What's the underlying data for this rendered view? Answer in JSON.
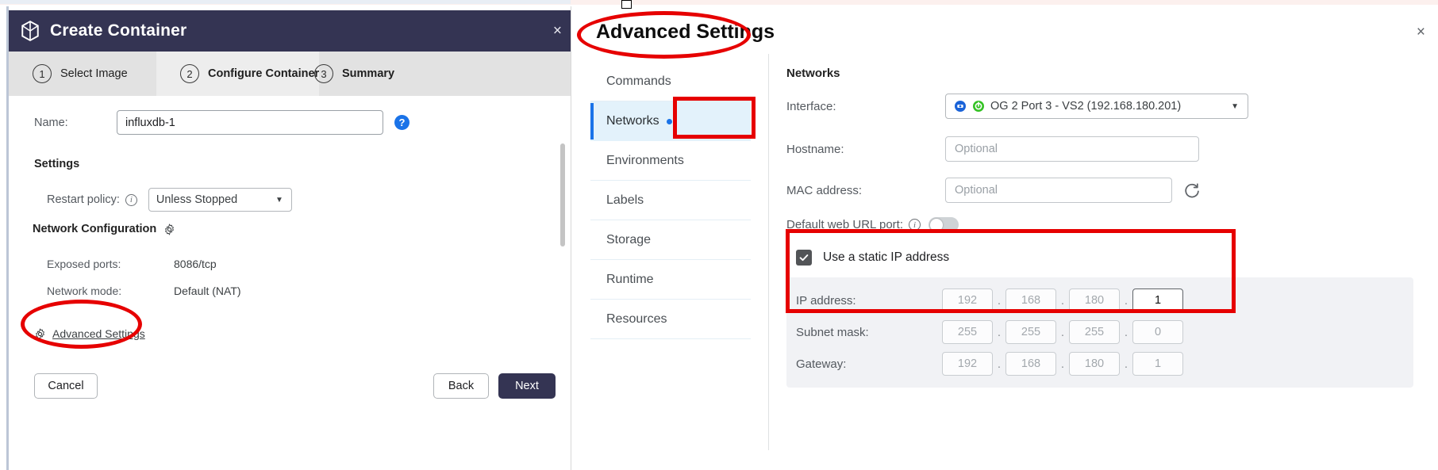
{
  "create_container": {
    "title": "Create Container",
    "title_icon": "cube-icon",
    "close_label": "×",
    "steps": [
      {
        "num": "1",
        "label": "Select Image",
        "active": false
      },
      {
        "num": "2",
        "label": "Configure Container",
        "active": true
      },
      {
        "num": "3",
        "label": "Summary",
        "active": false
      }
    ],
    "name_label": "Name:",
    "name_value": "influxdb-1",
    "name_help_glyph": "?",
    "settings_heading": "Settings",
    "restart_label": "Restart policy:",
    "restart_value": "Unless Stopped",
    "network_config_heading": "Network Configuration",
    "exposed_ports_label": "Exposed ports:",
    "exposed_ports_value": "8086/tcp",
    "network_mode_label": "Network mode:",
    "network_mode_value": "Default (NAT)",
    "advanced_settings_link": "Advanced Settings",
    "cancel_label": "Cancel",
    "back_label": "Back",
    "next_label": "Next"
  },
  "advanced_settings": {
    "title": "Advanced Settings",
    "close_label": "×",
    "nav_items": [
      {
        "label": "Commands",
        "active": false,
        "dot": false
      },
      {
        "label": "Networks",
        "active": true,
        "dot": true
      },
      {
        "label": "Environments",
        "active": false,
        "dot": false
      },
      {
        "label": "Labels",
        "active": false,
        "dot": false
      },
      {
        "label": "Storage",
        "active": false,
        "dot": false
      },
      {
        "label": "Runtime",
        "active": false,
        "dot": false
      },
      {
        "label": "Resources",
        "active": false,
        "dot": false
      }
    ],
    "networks": {
      "heading": "Networks",
      "interface_label": "Interface:",
      "interface_value": "OG 2 Port 3 - VS2 (192.168.180.201)",
      "hostname_label": "Hostname:",
      "hostname_placeholder": "Optional",
      "mac_label": "MAC address:",
      "mac_placeholder": "Optional",
      "weburl_label": "Default web URL port:",
      "weburl_toggle_on": false,
      "static_ip_label": "Use a static IP address",
      "static_ip_checked": true,
      "ip_rows": [
        {
          "label": "IP address:",
          "octets": [
            "192",
            "168",
            "180",
            "1"
          ],
          "filled": [
            false,
            false,
            false,
            true
          ]
        },
        {
          "label": "Subnet mask:",
          "octets": [
            "255",
            "255",
            "255",
            "0"
          ],
          "filled": [
            false,
            false,
            false,
            false
          ]
        },
        {
          "label": "Gateway:",
          "octets": [
            "192",
            "168",
            "180",
            "1"
          ],
          "filled": [
            false,
            false,
            false,
            false
          ]
        }
      ]
    }
  },
  "annotations": {
    "color": "#e60000",
    "shapes": [
      {
        "name": "advanced-settings-link-ellipse",
        "kind": "ellipse"
      },
      {
        "name": "advanced-settings-title-ellipse",
        "kind": "ellipse"
      },
      {
        "name": "networks-tab-rect",
        "kind": "rect"
      },
      {
        "name": "static-ip-rect",
        "kind": "rect"
      }
    ]
  }
}
